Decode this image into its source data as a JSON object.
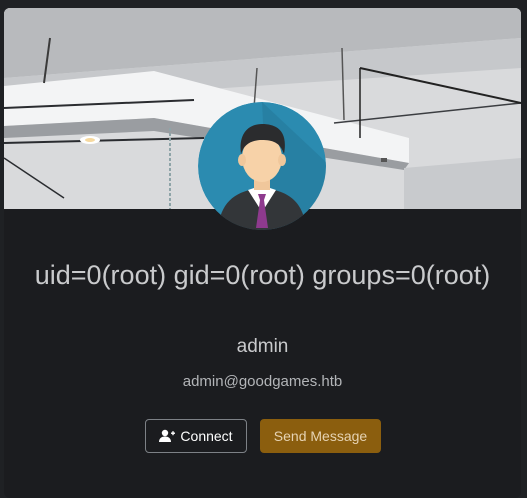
{
  "profile": {
    "display_name": "uid=0(root) gid=0(root) groups=0(root)",
    "username": "admin",
    "email": "admin@goodgames.htb"
  },
  "actions": {
    "connect_label": "Connect",
    "connect_icon": "user-plus-icon",
    "message_label": "Send Message"
  },
  "colors": {
    "card_background": "#1b1c1f",
    "message_button": "#8b5e0e",
    "avatar_background": "#2b8bb0"
  }
}
